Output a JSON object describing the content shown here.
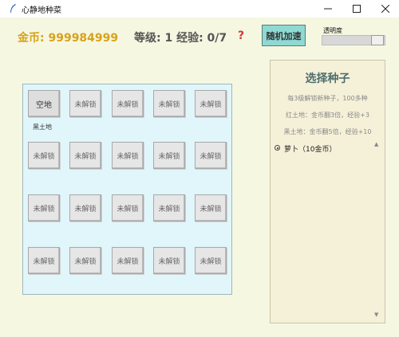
{
  "window": {
    "title": "心静地种菜"
  },
  "header": {
    "gold": "金币: 999984999",
    "level": "等级: 1 经验: 0/7",
    "help": "?",
    "speed_button": "随机加速",
    "opacity_label": "透明度",
    "opacity_value": 0.85
  },
  "field": {
    "plots": [
      [
        "空地",
        "未解锁",
        "未解锁",
        "未解锁",
        "未解锁"
      ],
      [
        "未解锁",
        "未解锁",
        "未解锁",
        "未解锁",
        "未解锁"
      ],
      [
        "未解锁",
        "未解锁",
        "未解锁",
        "未解锁",
        "未解锁"
      ],
      [
        "未解锁",
        "未解锁",
        "未解锁",
        "未解锁",
        "未解锁"
      ]
    ],
    "first_soil": "黑土地"
  },
  "seed_panel": {
    "title": "选择种子",
    "lines": [
      "每3级解锁新种子，100多种",
      "红土地：金币翻3倍，经验+3",
      "黑土地：金币翻5倍，经验+10"
    ],
    "seeds": [
      "萝卜（10金币）"
    ],
    "selected": 0
  }
}
